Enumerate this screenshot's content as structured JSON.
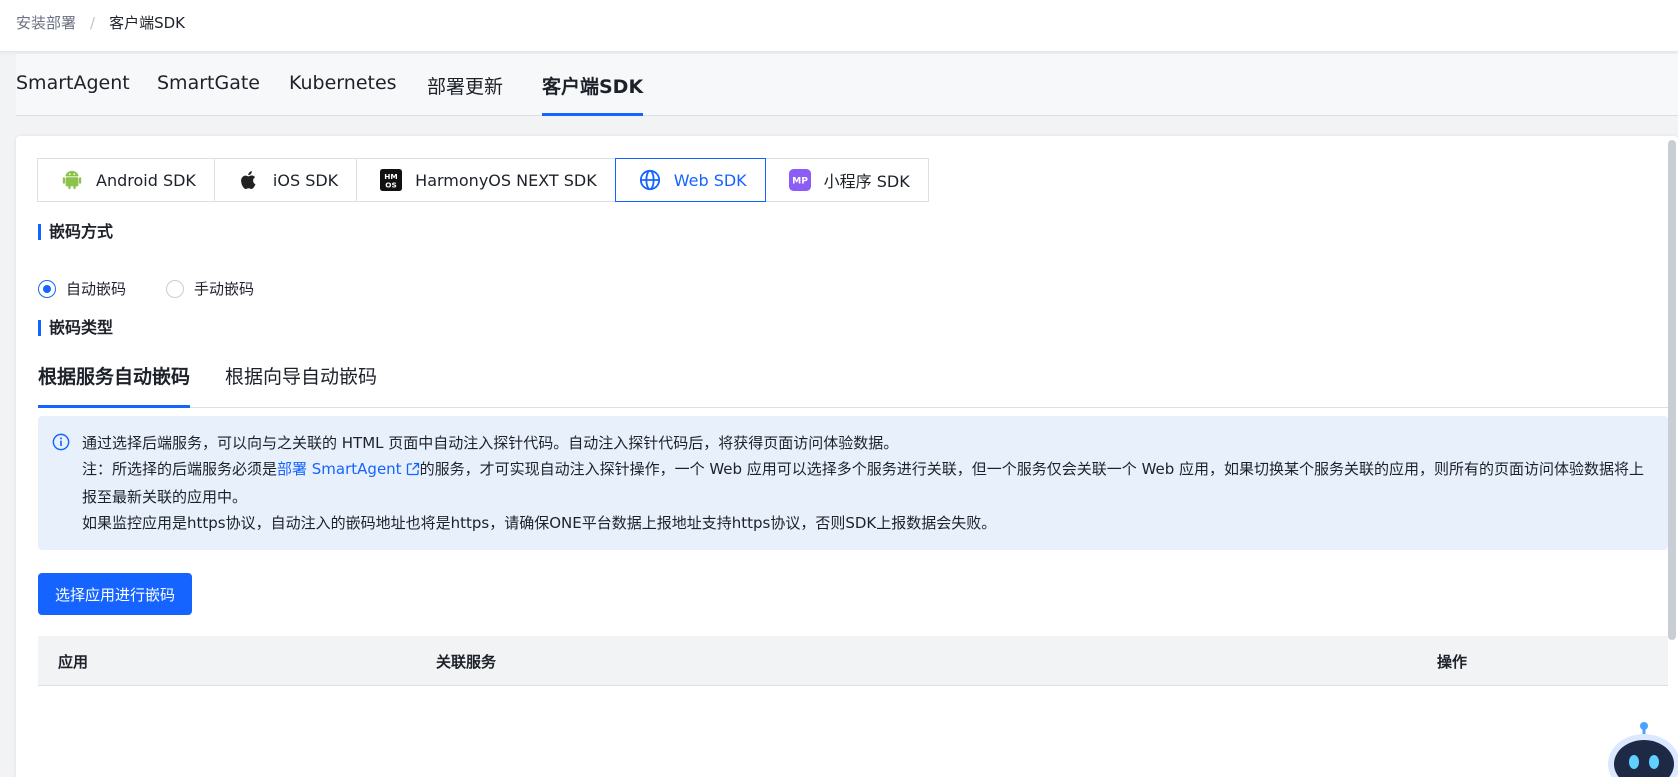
{
  "breadcrumb": {
    "root": "安装部署",
    "separator": "/",
    "current": "客户端SDK"
  },
  "main_tabs": [
    {
      "label": "SmartAgent"
    },
    {
      "label": "SmartGate"
    },
    {
      "label": "Kubernetes"
    },
    {
      "label": "部署更新"
    },
    {
      "label": "客户端SDK",
      "active": true
    }
  ],
  "sdk_tabs": [
    {
      "label": "Android SDK",
      "icon": "android-icon"
    },
    {
      "label": "iOS SDK",
      "icon": "apple-icon"
    },
    {
      "label": "HarmonyOS NEXT SDK",
      "icon": "harmonyos-icon"
    },
    {
      "label": "Web SDK",
      "icon": "globe-icon",
      "active": true
    },
    {
      "label": "小程序 SDK",
      "icon": "miniprogram-icon"
    }
  ],
  "embed_method": {
    "title": "嵌码方式",
    "options": [
      {
        "label": "自动嵌码",
        "checked": true
      },
      {
        "label": "手动嵌码",
        "checked": false
      }
    ]
  },
  "embed_type": {
    "title": "嵌码类型",
    "tabs": [
      {
        "label": "根据服务自动嵌码",
        "active": true
      },
      {
        "label": "根据向导自动嵌码"
      }
    ]
  },
  "alert": {
    "line1": "通过选择后端服务，可以向与之关联的 HTML 页面中自动注入探针代码。自动注入探针代码后，将获得页面访问体验数据。",
    "line2_prefix": "注：所选择的后端服务必须是",
    "line2_link": "部署 SmartAgent",
    "line2_suffix": "的服务，才可实现自动注入探针操作，一个 Web 应用可以选择多个服务进行关联，但一个服务仅会关联一个 Web 应用，如果切换某个服务关联的应用，则所有的页面访问体验数据将上报至最新关联的应用中。",
    "line3": "如果监控应用是https协议，自动注入的嵌码地址也将是https，请确保ONE平台数据上报地址支持https协议，否则SDK上报数据会失败。"
  },
  "select_button": "选择应用进行嵌码",
  "table": {
    "columns": [
      "应用",
      "关联服务",
      "操作"
    ]
  },
  "colors": {
    "accent": "#1664ff",
    "alert_bg": "#e8f0fb"
  }
}
